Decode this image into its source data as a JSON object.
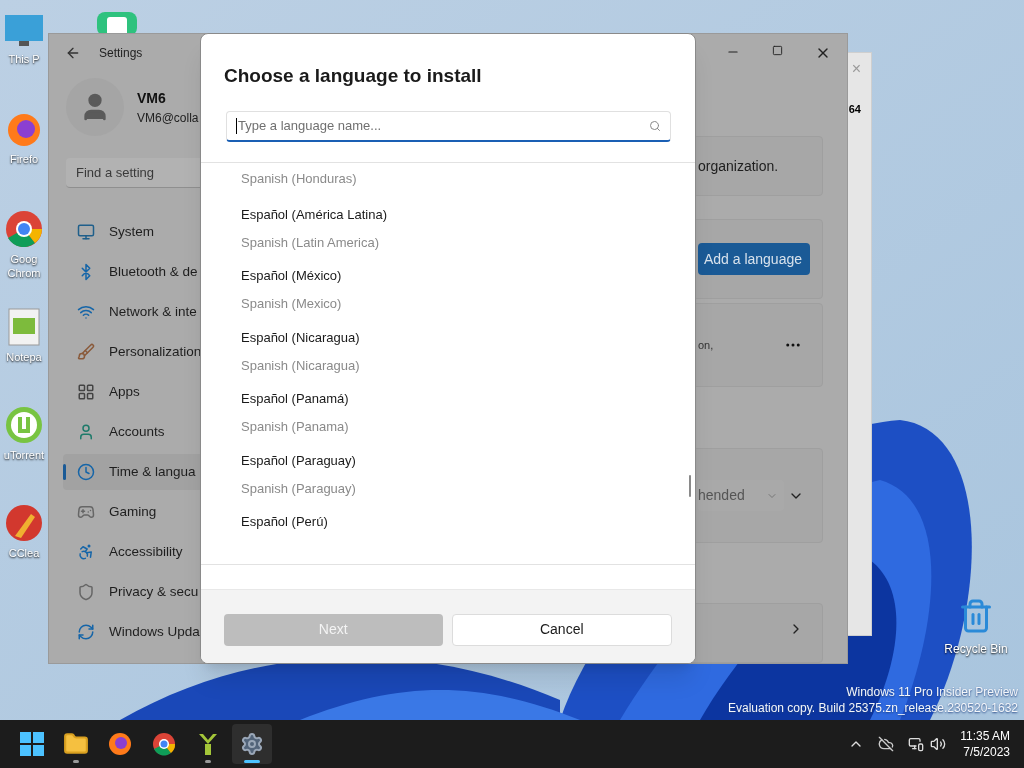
{
  "desktop": {
    "icons": [
      {
        "kind": "pc",
        "label": "This P"
      },
      {
        "kind": "firefox",
        "label": "Firefo"
      },
      {
        "kind": "chrome",
        "label": "Goog Chrom"
      },
      {
        "kind": "notepad",
        "label": "Notepa"
      },
      {
        "kind": "utorrent",
        "label": "uTorrent"
      },
      {
        "kind": "ccleaner",
        "label": "CClea"
      }
    ],
    "recycle_bin": {
      "label": "Recycle Bin"
    },
    "watermark": [
      "Windows 11 Pro Insider Preview",
      "Evaluation copy. Build 25375.zn_release.230520-1632"
    ]
  },
  "back_window": {
    "close": "×",
    "text": "64"
  },
  "settings": {
    "title": "Settings",
    "user": {
      "name": "VM6",
      "email": "VM6@colla"
    },
    "search": {
      "placeholder": "Find a setting"
    },
    "nav": [
      {
        "kind": "system",
        "label": "System",
        "selected": false
      },
      {
        "kind": "bluetooth",
        "label": "Bluetooth & de",
        "selected": false
      },
      {
        "kind": "network",
        "label": "Network & inte",
        "selected": false
      },
      {
        "kind": "personalization",
        "label": "Personalization",
        "selected": false
      },
      {
        "kind": "apps",
        "label": "Apps",
        "selected": false
      },
      {
        "kind": "accounts",
        "label": "Accounts",
        "selected": false
      },
      {
        "kind": "time",
        "label": "Time & langua",
        "selected": true
      },
      {
        "kind": "gaming",
        "label": "Gaming",
        "selected": false
      },
      {
        "kind": "accessibility",
        "label": "Accessibility",
        "selected": false
      },
      {
        "kind": "privacy",
        "label": "Privacy & secu",
        "selected": false
      },
      {
        "kind": "update",
        "label": "Windows Upda",
        "selected": false
      }
    ],
    "cards": [
      {
        "kind": "text",
        "text": "organization."
      },
      {
        "kind": "button",
        "label": "Add a language"
      },
      {
        "kind": "more",
        "text": "on,"
      },
      {
        "kind": "dropdown",
        "value": "hended"
      },
      {
        "kind": "link"
      }
    ]
  },
  "dialog": {
    "title": "Choose a language to install",
    "search": {
      "placeholder": "Type a language name..."
    },
    "languages": [
      {
        "english": "Spanish (Honduras)"
      },
      {
        "native": "Español (América Latina)",
        "english": "Spanish (Latin America)"
      },
      {
        "native": "Español (México)",
        "english": "Spanish (Mexico)"
      },
      {
        "native": "Español (Nicaragua)",
        "english": "Spanish (Nicaragua)"
      },
      {
        "native": "Español (Panamá)",
        "english": "Spanish (Panama)"
      },
      {
        "native": "Español (Paraguay)",
        "english": "Spanish (Paraguay)"
      },
      {
        "native": "Español (Perú)"
      }
    ],
    "buttons": [
      {
        "kind": "primary",
        "label": "Next",
        "disabled": true
      },
      {
        "kind": "secondary",
        "label": "Cancel",
        "disabled": false
      }
    ]
  },
  "taskbar": {
    "apps": [
      {
        "kind": "start",
        "running": false,
        "active": false
      },
      {
        "kind": "explorer",
        "running": true,
        "active": false
      },
      {
        "kind": "firefox",
        "running": false,
        "active": false
      },
      {
        "kind": "chrome",
        "running": false,
        "active": false
      },
      {
        "kind": "android",
        "running": true,
        "active": false
      },
      {
        "kind": "settings",
        "running": true,
        "active": true
      }
    ],
    "time": "11:35 AM",
    "date": "7/5/2023"
  }
}
